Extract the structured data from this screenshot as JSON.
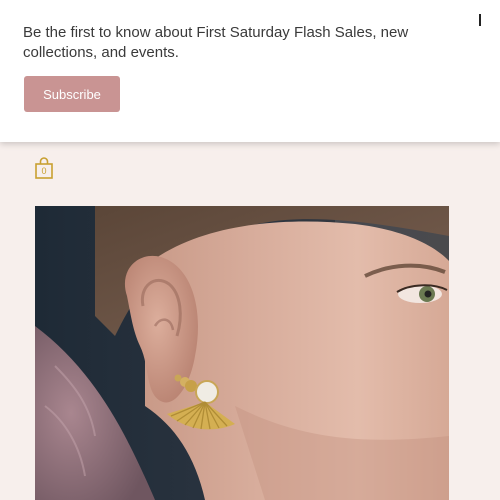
{
  "newsletter": {
    "message": "Be the first to know about First Saturday Flash Sales, new collections, and events.",
    "subscribe_label": "Subscribe",
    "close_icon": "close-icon"
  },
  "header": {
    "cart_icon": "shopping-bag-icon",
    "cart_count": "0"
  },
  "product_image": {
    "icon": "earring-photo"
  },
  "colors": {
    "page_background": "#f7efec",
    "subscribe_button": "#c99493",
    "cart_accent": "#c8a030"
  }
}
